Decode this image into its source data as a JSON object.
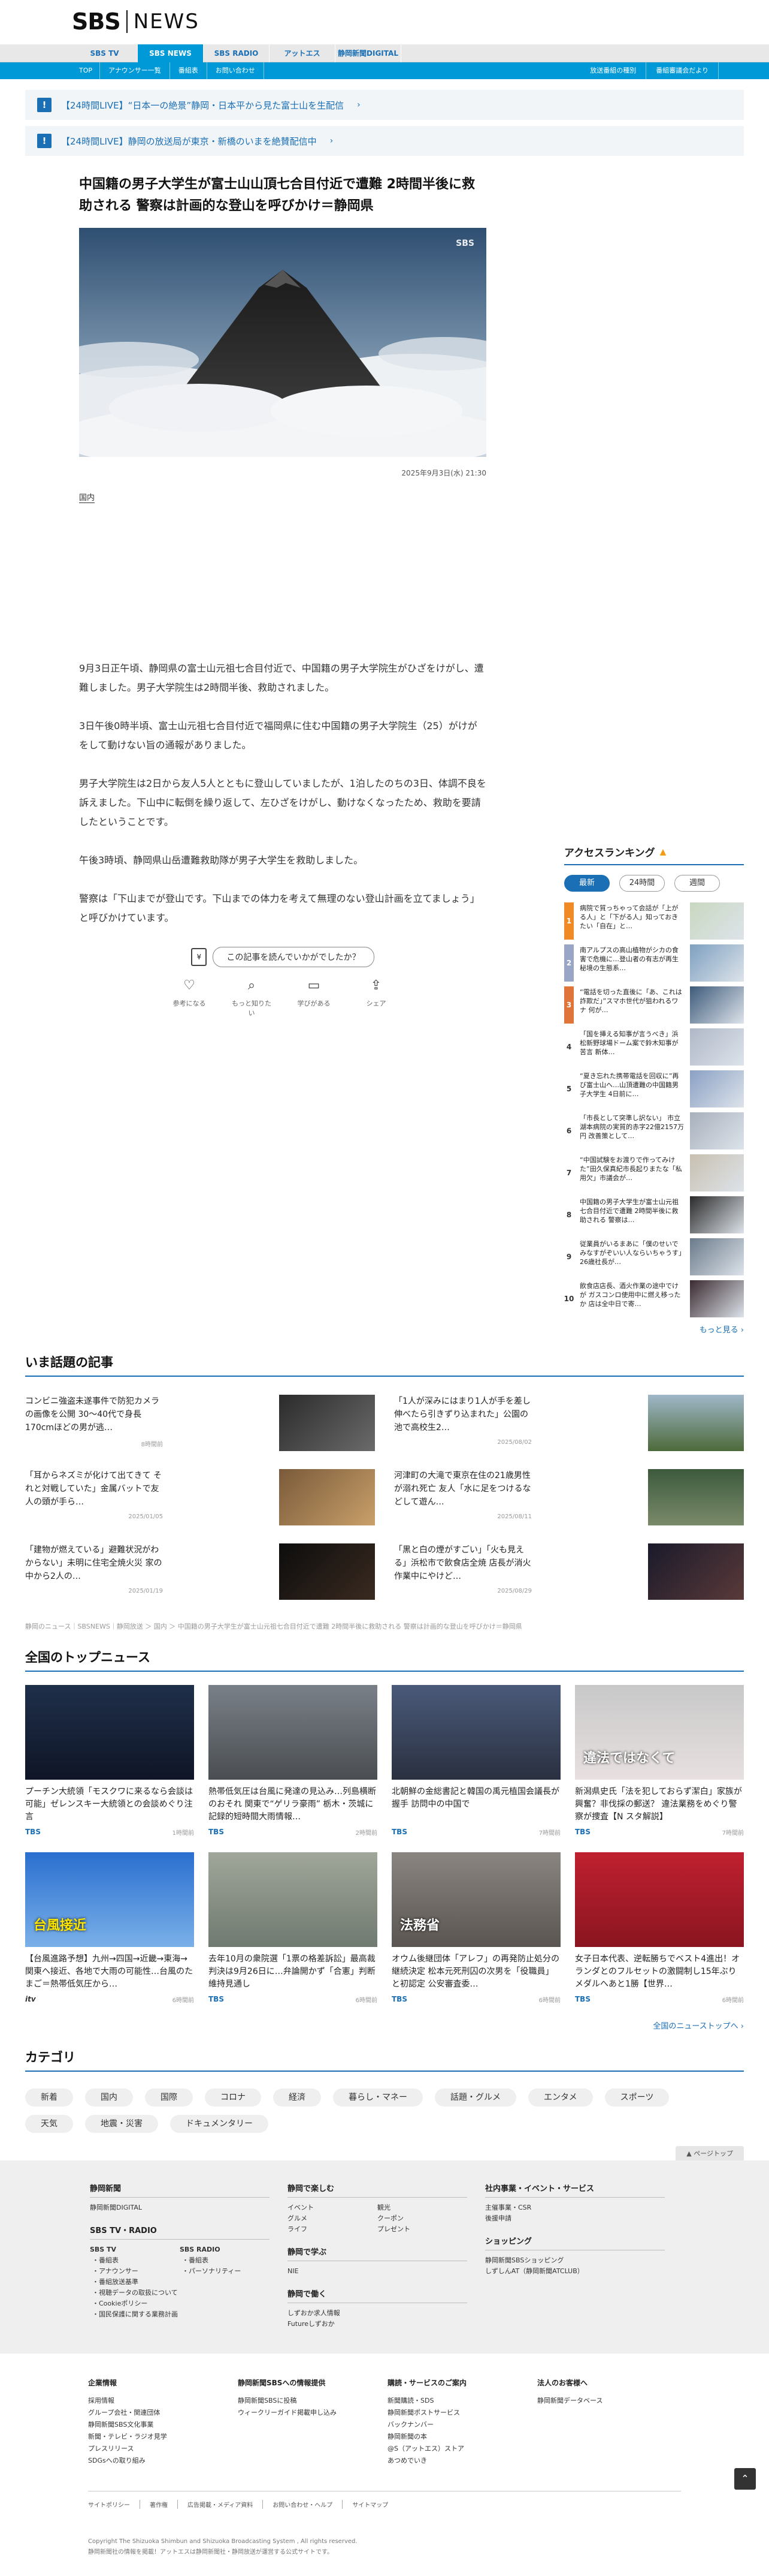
{
  "header": {
    "logo_main": "SBS",
    "logo_sub": "NEWS"
  },
  "global_nav": [
    "SBS TV",
    "SBS NEWS",
    "SBS RADIO",
    "アットエス",
    "静岡新聞DIGITAL"
  ],
  "sub_nav": {
    "left": [
      "TOP",
      "アナウンサー一覧",
      "番組表",
      "お問い合わせ"
    ],
    "right": [
      "放送番組の種別",
      "番組審議会だより"
    ]
  },
  "alerts": [
    "【24時間LIVE】“日本一の絶景”静岡・日本平から見た富士山を生配信",
    "【24時間LIVE】静岡の放送局が東京・新橋のいまを絶賛配信中"
  ],
  "article": {
    "headline": "中国籍の男子大学生が富士山山頂七合目付近で遭難 2時間半後に救助される 警察は計画的な登山を呼びかけ＝静岡県",
    "hero_mark": "SBS",
    "date": "2025年9月3日(水) 21:30",
    "category": "国内",
    "paragraphs": [
      "9月3日正午頃、静岡県の富士山元祖七合目付近で、中国籍の男子大学院生がひざをけがし、遭難しました。男子大学院生は2時間半後、救助されました。",
      "3日午後0時半頃、富士山元祖七合目付近で福岡県に住む中国籍の男子大学院生（25）がけがをして動けない旨の通報がありました。",
      "男子大学院生は2日から友人5人とともに登山していましたが、1泊したのちの3日、体調不良を訴えました。下山中に転倒を繰り返して、左ひざをけがし、動けなくなったため、救助を要請したということです。",
      "午後3時頃、静岡県山岳遭難救助隊が男子大学生を救助しました。",
      "警察は「下山までが登山です。下山までの体力を考えて無理のない登山計画を立てましょう」と呼びかけています。"
    ],
    "feedback": {
      "question": "この記事を読んでいかがでしたか？",
      "icon_text": "¥",
      "options": [
        {
          "icon": "♡",
          "label": "参考になる"
        },
        {
          "icon": "⌕",
          "label": "もっと知りたい"
        },
        {
          "icon": "▭",
          "label": "学びがある"
        },
        {
          "icon": "⇪",
          "label": "シェア"
        }
      ]
    }
  },
  "ranking": {
    "title": "アクセスランキング",
    "tabs": [
      "最新",
      "24時間",
      "週間"
    ],
    "items": [
      {
        "no": "1",
        "text": "病院で質っちゃって会話が「上がる人」と「下がる人」知っておきたい「自在」と…"
      },
      {
        "no": "2",
        "text": "南アルプスの高山植物がシカの食害で危機に…登山者の有志が再生 秘境の生態系…"
      },
      {
        "no": "3",
        "text": "“電話を切った直後に「あ、これは詐欺だ」”スマホ世代が狙われるワナ 何が…"
      },
      {
        "no": "4",
        "text": "「国を挿える知事が言うべき」浜松新野球場ドーム案で鈴木知事が苦言 新体…"
      },
      {
        "no": "5",
        "text": "“夏き忘れた携帯電話を回収に”再び富士山へ…山頂遭難の中国籍男子大学生 4日前に…"
      },
      {
        "no": "6",
        "text": "「市長として突準し訳ない」 市立湖本病院の実質的赤字22億2157万円 改善策として…"
      },
      {
        "no": "7",
        "text": "“中国試験をお渡りで作ってみけた”田久保真紀市長起りまたな「私用欠」市議会が…"
      },
      {
        "no": "8",
        "text": "中国籍の男子大学生が富士山元祖七合目付近で遭難 2時間半後に救助される 警察は…"
      },
      {
        "no": "9",
        "text": "従業員がいるまあに「僕のせいでみなすがぞいい人ならいちゃうす」26歳社長が…"
      },
      {
        "no": "10",
        "text": "飲食店店長、酒火作業の途中でけが ガスコンロ使用中に燃え移ったか 店は全中日で寄…"
      }
    ],
    "more": "もっと見る ›"
  },
  "trending": {
    "title": "いま話題の記事",
    "items": [
      {
        "title": "コンビニ強盗未遂事件で防犯カメラの画像を公開 30～40代で身長170cmほどの男が逃…",
        "date": "8時間前"
      },
      {
        "title": "「1人が深みにはまり1人が手を差し伸べたら引きずり込まれた」公園の池で高校生2…",
        "date": "2025/08/02"
      },
      {
        "title": "「耳からネズミが化けて出てきて それと対戦していた」金属バットで友人の頭が手ら…",
        "date": "2025/01/05"
      },
      {
        "title": "河津町の大滝で東京在住の21歳男性が溺れ死亡 友人「水に足をつけるなどして遊ん…",
        "date": "2025/08/11"
      },
      {
        "title": "「建物が燃えている」避難状況がわからない」未明に住宅全焼火災 家の中から2人の…",
        "date": "2025/01/19"
      },
      {
        "title": "「黒と白の煙がすごい」「火も見える」浜松市で飲食店全焼 店長が消火作業中にやけど…",
        "date": "2025/08/29"
      }
    ]
  },
  "breadcrumb": "静岡のニュース｜SBSNEWS｜静岡放送 ＞ 国内 ＞ 中国籍の男子大学生が富士山元祖七合目付近で遭難 2時間半後に救助される 警察は計画的な登山を呼びかけ＝静岡県",
  "top_news": {
    "title": "全国のトップニュース",
    "items": [
      {
        "title": "プーチン大統領「モスクワに来るなら会談は可能」ゼレンスキー大統領との会談めぐり注言",
        "src": "TBS",
        "ago": "1時間前"
      },
      {
        "title": "熱帯低気圧は台風に発達の見込み…列島横断のおそれ 関東で“ゲリラ豪雨” 栃木・茨城に記録的短時間大雨情報…",
        "src": "TBS",
        "ago": "2時間前"
      },
      {
        "title": "北朝鮮の金総書記と韓国の禹元植国会議長が握手 訪問中の中国で",
        "src": "TBS",
        "ago": "7時間前"
      },
      {
        "title": "新潟県史氏「法を犯しておらず潔白」家族が興奮？非伐採の郵送？ 違法業務をめぐり警察が捜査【N スタ解説】",
        "src": "TBS",
        "ago": "7時間前"
      },
      {
        "title": "【台風進路予想】九州→四国→近畿→東海→関東へ接近、各地で大雨の可能性…台風のたまご＝熱帯低気圧から…",
        "src": "itv",
        "ago": "6時間前"
      },
      {
        "title": "去年10月の衆院選「1票の格差訴訟」最高裁判決は9月26日に…弁論開かず「合憲」判断維持見通し",
        "src": "TBS",
        "ago": "6時間前"
      },
      {
        "title": "オウム後継団体「アレフ」の再発防止処分の継続決定 松本元死刑囚の次男を「役職員」と初認定 公安審査委…",
        "src": "TBS",
        "ago": "6時間前"
      },
      {
        "title": "女子日本代表、逆転勝ちでベスト4進出！オランダとのフルセットの激闘制し15年ぶりメダルへあと1勝【世界…",
        "src": "TBS",
        "ago": "6時間前"
      }
    ],
    "thumb_captions": [
      "",
      "",
      "",
      "違法ではなくて",
      "台風接近",
      "",
      "法務省",
      ""
    ],
    "more": "全国のニューストップへ ›"
  },
  "categories": {
    "title": "カテゴリ",
    "items": [
      "新着",
      "国内",
      "国際",
      "コロナ",
      "経済",
      "暮らし・マネー",
      "話題・グルメ",
      "エンタメ",
      "スポーツ",
      "天気",
      "地震・災害",
      "ドキュメンタリー"
    ]
  },
  "page_top": "▲ ページトップ",
  "footer1": {
    "col1": {
      "h1": "静岡新聞",
      "l1": [
        "静岡新聞DIGITAL"
      ],
      "h2": "SBS TV・RADIO",
      "tv_h": "SBS TV",
      "tv": [
        "・番組表",
        "・アナウンサー",
        "・番組放送基準",
        "・視聴データの取扱について",
        "・Cookieポリシー",
        "・国民保護に関する業務計画"
      ],
      "radio_h": "SBS RADIO",
      "radio": [
        "・番組表",
        "・パーソナリティー"
      ]
    },
    "col2": {
      "h1": "静岡で楽しむ",
      "l1": [
        "イベント",
        "観光",
        "グルメ",
        "クーポン",
        "ライフ",
        "プレゼント"
      ],
      "h2": "静岡で学ぶ",
      "l2": [
        "NIE"
      ],
      "h3": "静岡で働く",
      "l3": [
        "しずおか求人情報",
        "Futureしずおか"
      ]
    },
    "col3": {
      "h1": "社内事業・イベント・サービス",
      "l1": [
        "主催事業・CSR",
        "後援申請"
      ],
      "h2": "ショッピング",
      "l2": [
        "静岡新聞SBSショッピング",
        "しずしんAT（静岡新聞ATCLUB）"
      ]
    }
  },
  "footer2": {
    "cols": [
      {
        "h": "企業情報",
        "items": [
          "採用情報",
          "グループ会社・関連団体",
          "静岡新聞SBS文化事業",
          "新聞・テレビ・ラジオ見学",
          "プレスリリース",
          "SDGsへの取り組み"
        ]
      },
      {
        "h": "静岡新聞SBSへの情報提供",
        "items": [
          "静岡新聞SBSに投稿",
          "ウィークリーガイド掲載申し込み"
        ]
      },
      {
        "h": "購読・サービスのご案内",
        "items": [
          "新聞購読・SDS",
          "静岡新聞ポストサービス",
          "バックナンバー",
          "静岡新聞の本",
          "@S（アットエス）ストア",
          "あつめでいき"
        ]
      },
      {
        "h": "法人のお客様へ",
        "items": [
          "静岡新聞データベース"
        ]
      }
    ],
    "links": [
      "サイトポリシー",
      "著作権",
      "広告掲載・メディア資料",
      "お問い合わせ・ヘルプ",
      "サイトマップ"
    ],
    "copyright": "Copyright The Shizuoka Shimbun and Shizuoka Broadcasting System , All rights reserved.",
    "note": "静岡新聞社の情報を掲載！アットエスは静岡新聞社・静岡放送が運営する公式サイトです。",
    "totop": "⌃"
  },
  "colors": {
    "accent": "#0099d8",
    "link": "#1a6fb5",
    "rank_fire": "#f39c12"
  }
}
